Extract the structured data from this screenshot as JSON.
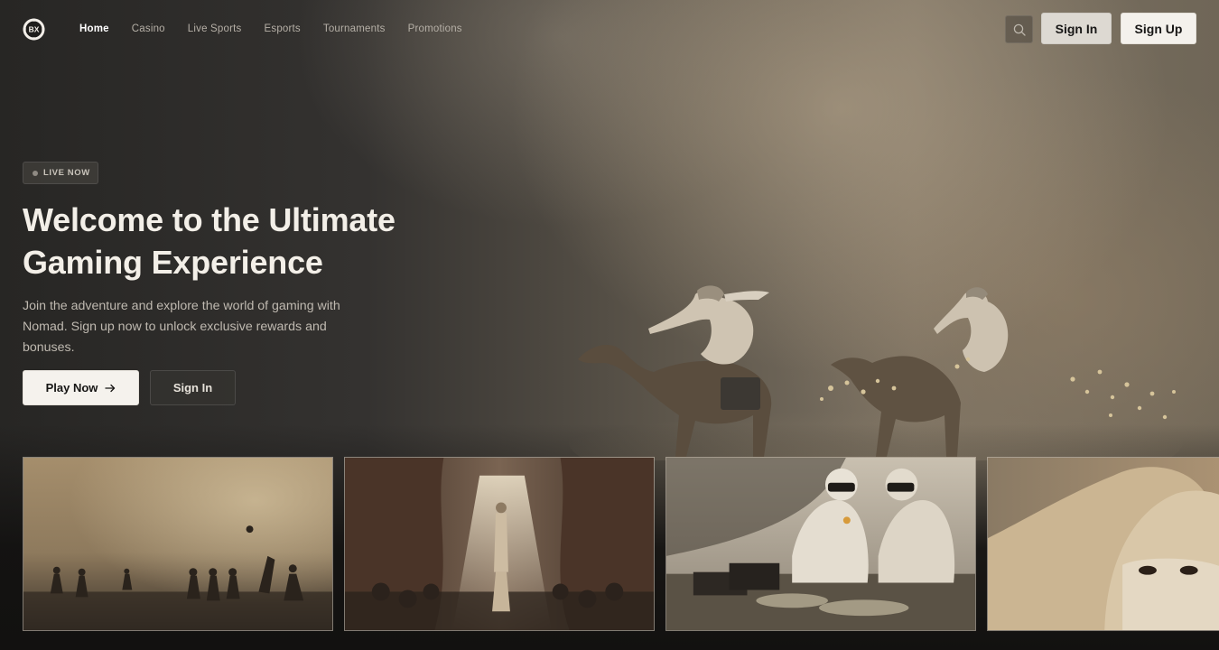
{
  "brand": {
    "logo_text": "BX"
  },
  "nav": {
    "links": [
      {
        "label": "Home",
        "active": true
      },
      {
        "label": "Casino",
        "active": false
      },
      {
        "label": "Live Sports",
        "active": false
      },
      {
        "label": "Esports",
        "active": false
      },
      {
        "label": "Tournaments",
        "active": false
      },
      {
        "label": "Promotions",
        "active": false
      }
    ],
    "search_icon": "search-icon",
    "sign_in_label": "Sign In",
    "sign_up_label": "Sign Up"
  },
  "hero": {
    "badge": "LIVE NOW",
    "title": "Welcome to the Ultimate Gaming Experience",
    "subtitle": "Join the adventure and explore the world of gaming with Nomad. Sign up now to unlock exclusive rewards and bonuses.",
    "play_label": "Play Now",
    "play_icon": "arrow-right-icon",
    "sign_in_label": "Sign In"
  },
  "colors": {
    "accent_light": "#f4f1ec",
    "background": "#121110",
    "coin": "#d6c49a"
  }
}
